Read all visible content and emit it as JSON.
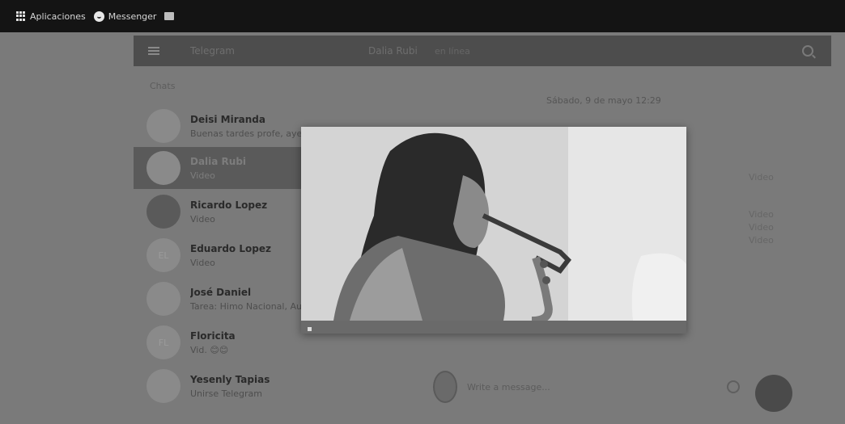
{
  "bookmarks": [
    {
      "label": "Aplicaciones",
      "icon": "apps-grid-icon"
    },
    {
      "label": "Messenger",
      "icon": "messenger-icon"
    },
    {
      "label": "",
      "icon": "bookmark-square-icon"
    }
  ],
  "header": {
    "title": "Telegram",
    "chat_title": "Dalia Rubi",
    "chat_subtitle": "en línea"
  },
  "sidebar": {
    "section": "Chats",
    "chats": [
      {
        "name": "Deisi Miranda",
        "preview": "Buenas tardes profe, ayer",
        "active": false
      },
      {
        "name": "Dalia Rubi",
        "preview": "Video",
        "active": true
      },
      {
        "name": "Ricardo Lopez",
        "preview": "Video",
        "active": false
      },
      {
        "name": "Eduardo Lopez",
        "preview": "Video",
        "active": false,
        "initials": "EL"
      },
      {
        "name": "José Daniel",
        "preview": "Tarea: Himo Nacional, Au",
        "active": false
      },
      {
        "name": "Floricita",
        "preview": "Vid. 😊😊",
        "active": false,
        "initials": "FL"
      },
      {
        "name": "Yesenly Tapias",
        "preview": "Unirse Telegram",
        "active": false
      }
    ]
  },
  "chat": {
    "date_label": "Sábado, 9 de mayo 12:29",
    "right_lines": [
      "Video",
      "Video",
      "Video",
      "Video"
    ],
    "composer_placeholder": "Write a message..."
  },
  "viewer": {
    "image_label": "saxophone-player-photo"
  }
}
